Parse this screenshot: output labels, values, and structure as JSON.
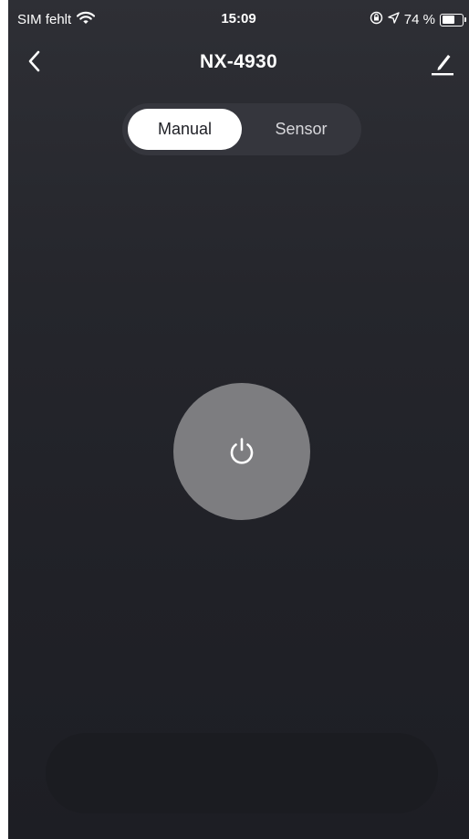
{
  "status_bar": {
    "carrier": "SIM fehlt",
    "time": "15:09",
    "battery_text": "74 %",
    "battery_level": 0.74,
    "icons": [
      "wifi-icon",
      "orientation-lock-icon",
      "location-arrow-icon",
      "battery-icon"
    ]
  },
  "nav": {
    "title": "NX-4930",
    "back_icon": "chevron-left-icon",
    "edit_icon": "pencil-icon"
  },
  "mode_toggle": {
    "options": [
      {
        "label": "Manual",
        "selected": true
      },
      {
        "label": "Sensor",
        "selected": false
      }
    ]
  },
  "power": {
    "icon": "power-icon",
    "state": "off"
  },
  "colors": {
    "background_top": "#2e2f35",
    "background_bottom": "#1d1e24",
    "segment_track": "#35363d",
    "segment_selected": "#ffffff",
    "power_button": "#7d7d80",
    "bottom_pill": "#1b1c21"
  }
}
